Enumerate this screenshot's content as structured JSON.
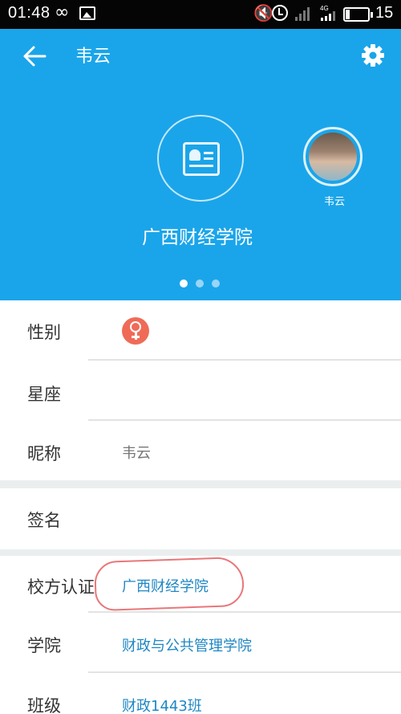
{
  "status_bar": {
    "time": "01:48",
    "network": "4G",
    "battery": "15"
  },
  "header": {
    "title": "韦云",
    "school": "广西财经学院",
    "avatar_name": "韦云",
    "page_count": 3,
    "active_page": 1
  },
  "profile": {
    "gender_label": "性别",
    "zodiac_label": "星座",
    "nickname_label": "昵称",
    "nickname_value": "韦云",
    "signature_label": "签名",
    "school_cert_label": "校方认证",
    "school_cert_value": "广西财经学院",
    "college_label": "学院",
    "college_value": "财政与公共管理学院",
    "class_label": "班级",
    "class_value": "财政1443班"
  },
  "colors": {
    "header_bg": "#1aa5ea",
    "link": "#1f87c4",
    "female_badge": "#ef6b57",
    "highlight_ink": "#e8777a"
  }
}
